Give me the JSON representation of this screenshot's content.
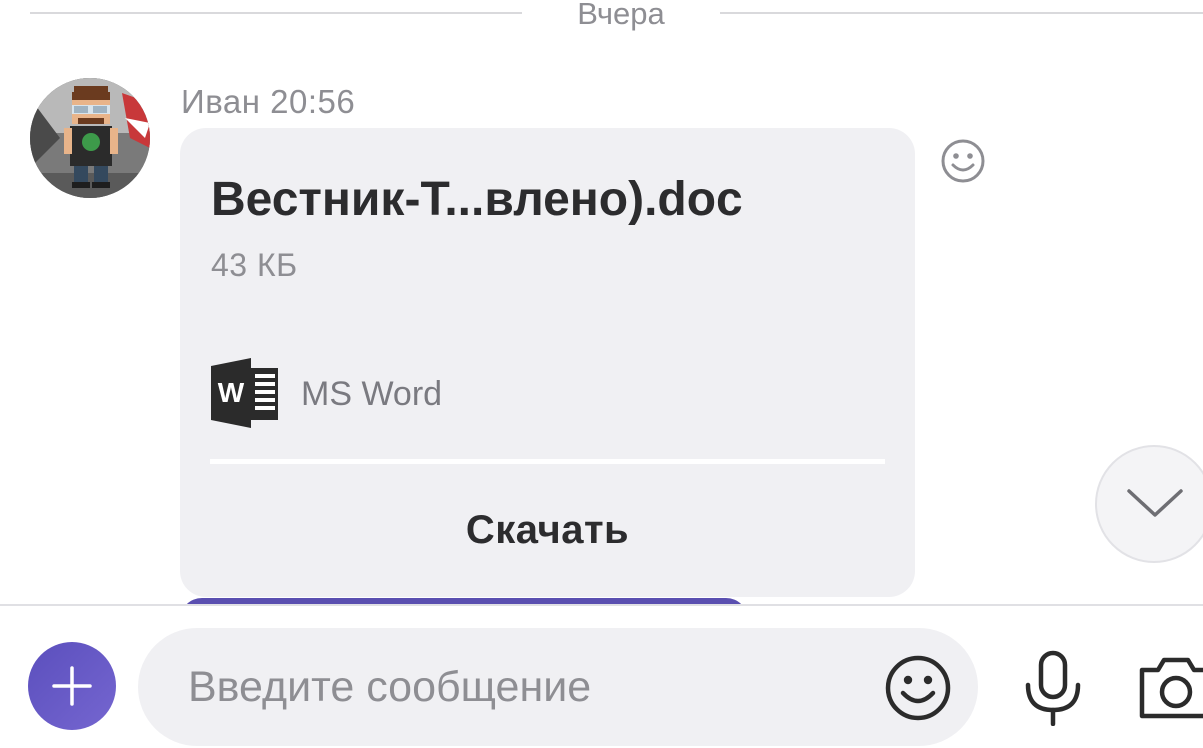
{
  "date_divider": {
    "label": "Вчера"
  },
  "message": {
    "sender": "Иван",
    "time": "20:56",
    "sender_line": "Иван 20:56",
    "avatar_icon": "user-avatar",
    "file": {
      "name": "Вестник-Т...влено).doc",
      "size": "43 КБ",
      "app_icon": "ms-word-icon",
      "app_name": "MS Word",
      "action_label": "Скачать"
    },
    "react_icon": "smile-icon"
  },
  "scroll_down": {
    "icon": "chevron-down-icon"
  },
  "composer": {
    "attach_icon": "plus-icon",
    "input_placeholder": "Введите сообщение",
    "input_value": "",
    "emoji_icon": "smile-icon",
    "mic_icon": "microphone-icon",
    "camera_icon": "camera-icon"
  },
  "colors": {
    "accent": "#5b4fbd",
    "bubble_bg": "#f0f0f3",
    "secondary_text": "#8e8e93"
  }
}
